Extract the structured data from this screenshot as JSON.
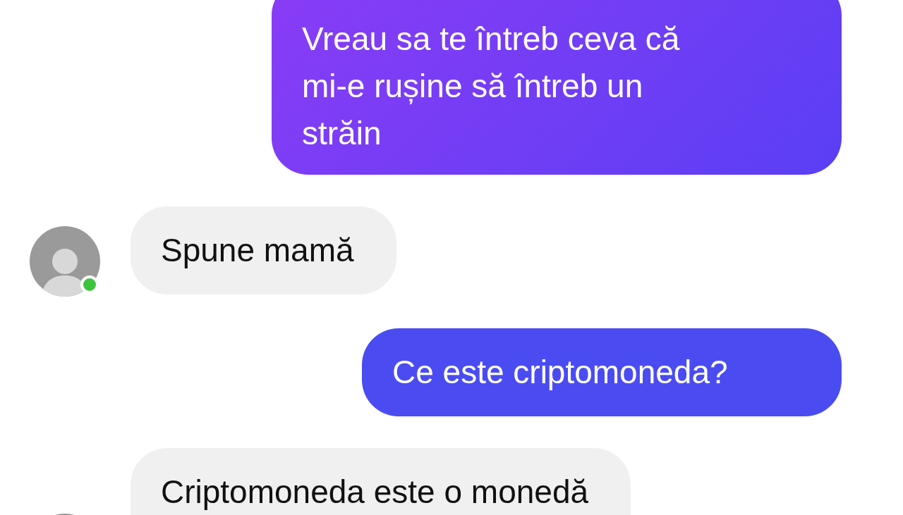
{
  "messages": [
    {
      "kind": "outgoing",
      "lines": [
        "Vreau sa te întreb ceva că",
        "mi-e rușine să întreb un",
        "străin"
      ]
    },
    {
      "kind": "incoming",
      "lines": [
        "Spune mamă"
      ],
      "avatar": {
        "online": true
      }
    },
    {
      "kind": "outgoing",
      "lines": [
        "Ce este criptomoneda?"
      ]
    },
    {
      "kind": "incoming",
      "lines": [
        "Criptomoneda este o monedă"
      ]
    }
  ]
}
